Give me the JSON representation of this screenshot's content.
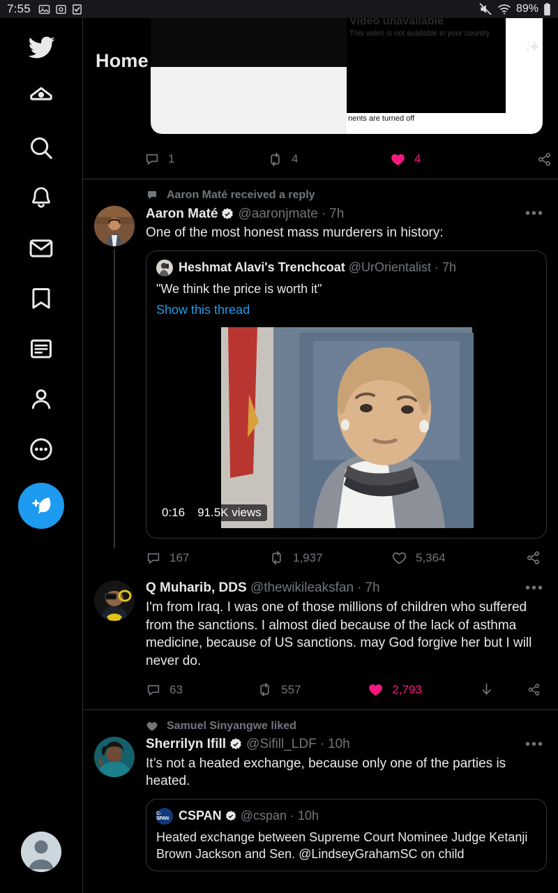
{
  "status_bar": {
    "time": "7:55",
    "left_icons": [
      "image-icon",
      "screenshot-icon",
      "checkbox-icon"
    ],
    "right_icons": [
      "mute-icon",
      "wifi-icon"
    ],
    "battery": "89%"
  },
  "sidebar": {
    "brand_icon": "twitter-bird-icon",
    "items": [
      {
        "name": "home",
        "icon": "home-icon"
      },
      {
        "name": "explore",
        "icon": "search-icon"
      },
      {
        "name": "notifications",
        "icon": "bell-icon"
      },
      {
        "name": "messages",
        "icon": "envelope-icon"
      },
      {
        "name": "bookmarks",
        "icon": "bookmark-icon"
      },
      {
        "name": "lists",
        "icon": "list-icon"
      },
      {
        "name": "profile",
        "icon": "person-icon"
      },
      {
        "name": "more",
        "icon": "more-circle-icon"
      }
    ],
    "compose": {
      "icon": "compose-feather-icon"
    },
    "account_avatar": "default-avatar-icon"
  },
  "header": {
    "title": "Home",
    "sparkle_icon": "sparkle-icon"
  },
  "top_partial_tweet": {
    "card": {
      "unavailable_title": "Video unavailable",
      "unavailable_subtitle": "This video is not available in your country",
      "comments_note": "nents are turned off"
    },
    "actions": {
      "reply": "1",
      "retweet": "4",
      "like": "4",
      "liked": true,
      "share_icon": "share-icon"
    }
  },
  "tweets": [
    {
      "context": {
        "icon": "reply-bubble-icon",
        "label": "Aaron Maté received a reply"
      },
      "display_name": "Aaron Maté",
      "verified": true,
      "handle": "@aaronjmate",
      "time": "7h",
      "text": "One of the most honest mass murderers in history:",
      "more_icon": "more-horizontal-icon",
      "quote": {
        "display_name": "Heshmat Alavi's Trenchcoat",
        "handle": "@UrOrientalist",
        "time": "7h",
        "text": "\"We think the price is worth it\"",
        "show_thread": "Show this thread",
        "media": {
          "duration": "0:16",
          "views": "91.5K views"
        }
      },
      "actions": {
        "reply": "167",
        "retweet": "1,937",
        "like": "5,364",
        "liked": false,
        "share_icon": "share-icon"
      }
    },
    {
      "display_name": "Q Muharib, DDS",
      "verified": false,
      "handle": "@thewikileaksfan",
      "time": "7h",
      "text": "I'm from Iraq. I was one of those millions of children who suffered from the sanctions. I almost died because of the lack of asthma medicine, because of US sanctions. may God forgive her but I will never do.",
      "more_icon": "more-horizontal-icon",
      "actions": {
        "reply": "63",
        "retweet": "557",
        "like": "2,793",
        "liked": true,
        "download_icon": "download-icon",
        "share_icon": "share-icon"
      }
    },
    {
      "context": {
        "icon": "heart-icon",
        "label": "Samuel Sinyangwe liked"
      },
      "display_name": "Sherrilyn Ifill",
      "verified": true,
      "handle": "@Sifill_LDF",
      "time": "10h",
      "text": "It’s not a heated exchange, because only one of the parties is heated.",
      "more_icon": "more-horizontal-icon",
      "quote": {
        "display_name": "CSPAN",
        "verified": true,
        "handle": "@cspan",
        "time": "10h",
        "avatar_text": "C-SPAN",
        "text": "Heated exchange between Supreme Court Nominee Judge Ketanji Brown Jackson and Sen. @LindseyGrahamSC on child"
      }
    }
  ],
  "colors": {
    "background": "#000000",
    "text_primary": "#e7e9ea",
    "text_secondary": "#71767b",
    "accent_blue": "#1d9bf0",
    "like_pink": "#f91880",
    "border": "#2f3336",
    "status_bar": "#16181c"
  }
}
